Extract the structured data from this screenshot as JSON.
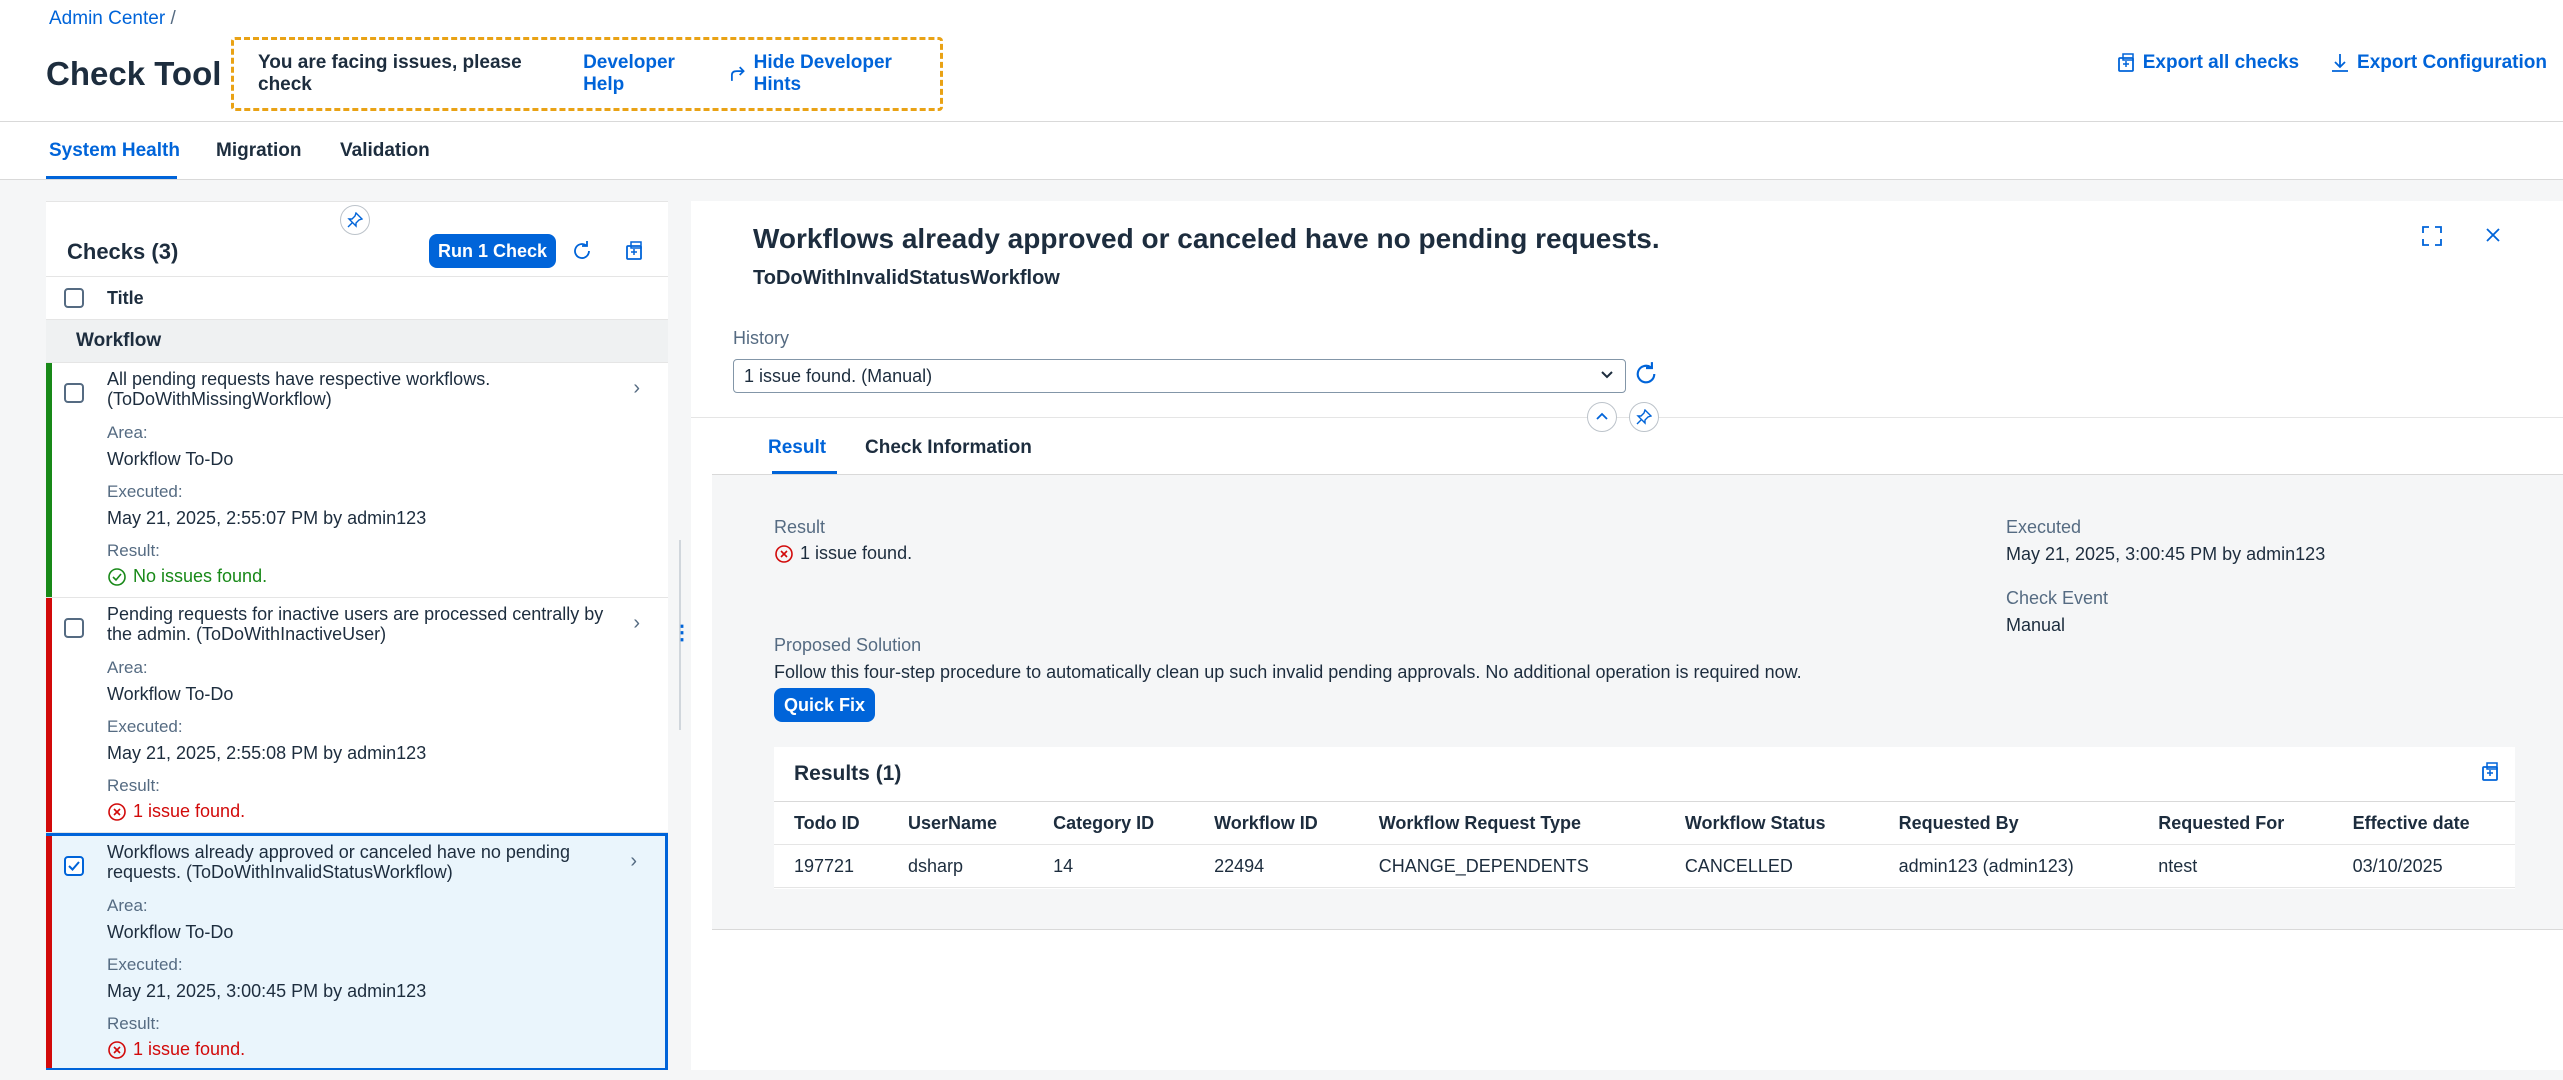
{
  "header": {
    "breadcrumb": "Admin Center",
    "breadcrumb_sep": "/",
    "title": "Check Tool",
    "hint_text": "You are facing issues, please check",
    "developer_help": "Developer Help",
    "hide_hints": "Hide Developer Hints",
    "export_all": "Export all checks",
    "export_config": "Export Configuration"
  },
  "tabs": [
    "System Health",
    "Migration",
    "Validation"
  ],
  "checks": {
    "title": "Checks (3)",
    "run_button": "Run 1 Check",
    "column_title": "Title",
    "group": "Workflow",
    "items": [
      {
        "title": "All pending requests have respective workflows. (ToDoWithMissingWorkflow)",
        "area_label": "Area:",
        "area": "Workflow To-Do",
        "executed_label": "Executed:",
        "executed": "May 21, 2025, 2:55:07 PM by admin123",
        "result_label": "Result:",
        "result": "No issues found.",
        "status": "success"
      },
      {
        "title": "Pending requests for inactive users are processed centrally by the admin. (ToDoWithInactiveUser)",
        "area_label": "Area:",
        "area": "Workflow To-Do",
        "executed_label": "Executed:",
        "executed": "May 21, 2025, 2:55:08 PM by admin123",
        "result_label": "Result:",
        "result": "1 issue found.",
        "status": "error"
      },
      {
        "title": "Workflows already approved or canceled have no pending requests. (ToDoWithInvalidStatusWorkflow)",
        "area_label": "Area:",
        "area": "Workflow To-Do",
        "executed_label": "Executed:",
        "executed": "May 21, 2025, 3:00:45 PM by admin123",
        "result_label": "Result:",
        "result": "1 issue found.",
        "status": "error"
      }
    ]
  },
  "detail": {
    "title": "Workflows already approved or canceled have no pending requests.",
    "subtitle": "ToDoWithInvalidStatusWorkflow",
    "history_label": "History",
    "history_value": "1 issue found. (Manual)",
    "tabs": [
      "Result",
      "Check Information"
    ],
    "result_label": "Result",
    "result_value": "1 issue found.",
    "executed_label": "Executed",
    "executed_value": "May 21, 2025, 3:00:45 PM by admin123",
    "check_event_label": "Check Event",
    "check_event_value": "Manual",
    "proposed_label": "Proposed Solution",
    "proposed_text": "Follow this four-step procedure to automatically clean up such invalid pending approvals. No additional operation is required now.",
    "quick_fix": "Quick Fix",
    "results_title": "Results (1)",
    "table": {
      "headers": [
        "Todo ID",
        "UserName",
        "Category ID",
        "Workflow ID",
        "Workflow Request Type",
        "Workflow Status",
        "Requested By",
        "Requested For",
        "Effective date"
      ],
      "rows": [
        [
          "197721",
          "dsharp",
          "14",
          "22494",
          "CHANGE_DEPENDENTS",
          "CANCELLED",
          "admin123 (admin123)",
          "ntest",
          "03/10/2025"
        ]
      ]
    }
  },
  "colors": {
    "accent": "#0064d9",
    "success": "#188918",
    "error": "#d20a0a",
    "hint_border": "#e9a215"
  }
}
